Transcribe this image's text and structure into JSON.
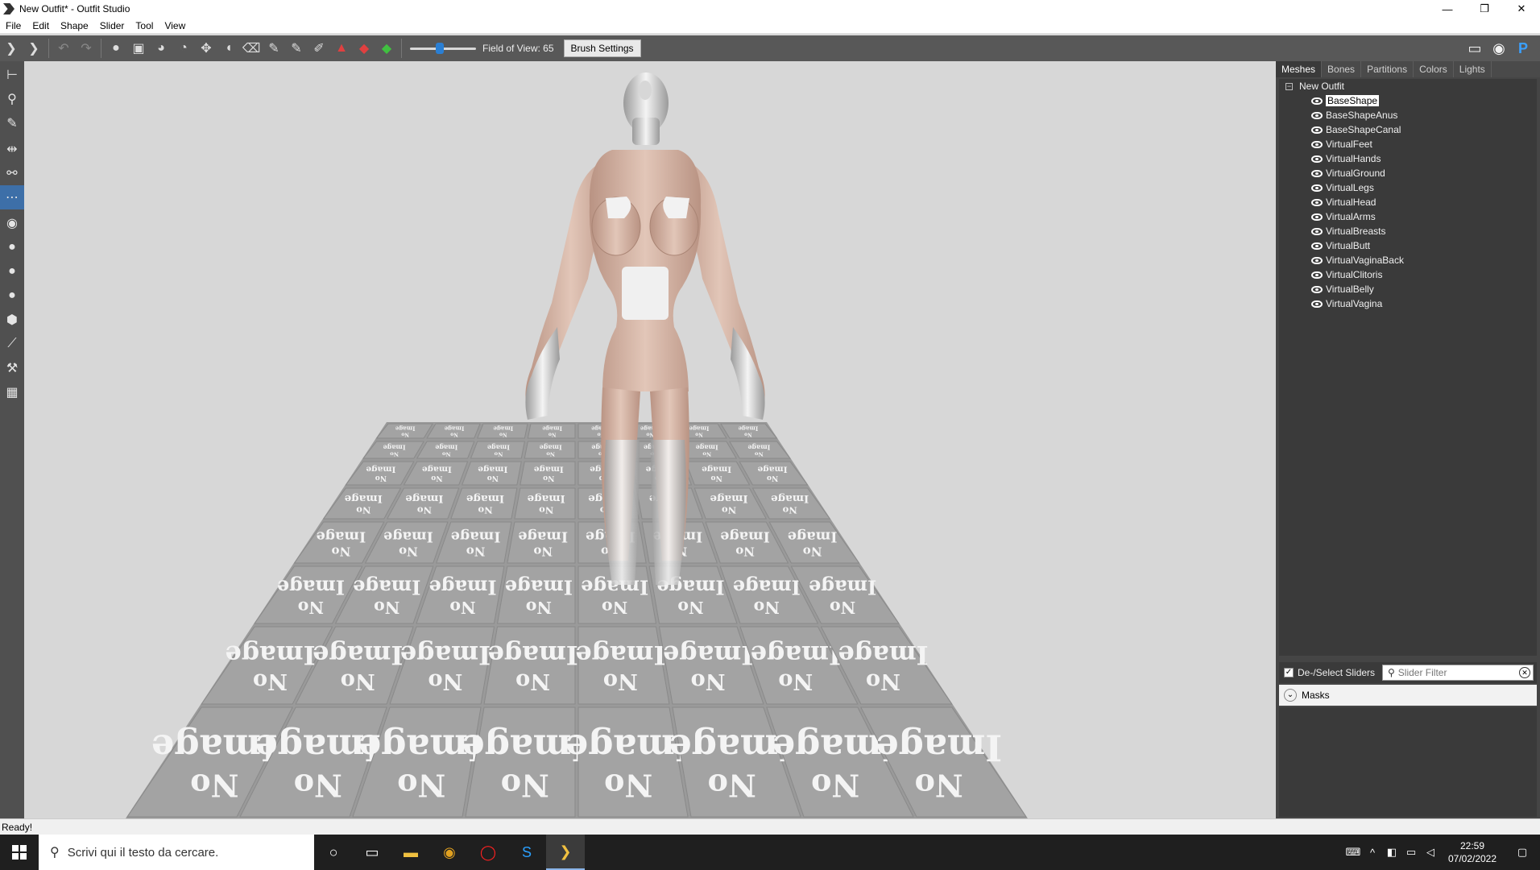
{
  "window": {
    "title": "New Outfit* - Outfit Studio",
    "minimize_glyph": "—",
    "restore_glyph": "❐",
    "close_glyph": "✕"
  },
  "menu": [
    "File",
    "Edit",
    "Shape",
    "Slider",
    "Tool",
    "View"
  ],
  "toolbar": {
    "fov_label": "Field of View: 65",
    "fov_value": 65,
    "fov_fraction": 0.45,
    "brush_settings_label": "Brush Settings"
  },
  "tabs": [
    "Meshes",
    "Bones",
    "Partitions",
    "Colors",
    "Lights"
  ],
  "tree": {
    "root": "New Outfit",
    "items": [
      "BaseShape",
      "BaseShapeAnus",
      "BaseShapeCanal",
      "VirtualFeet",
      "VirtualHands",
      "VirtualGround",
      "VirtualLegs",
      "VirtualHead",
      "VirtualArms",
      "VirtualBreasts",
      "VirtualButt",
      "VirtualVaginaBack",
      "VirtualClitoris",
      "VirtualBelly",
      "VirtualVagina"
    ],
    "selected": "BaseShape"
  },
  "sliders": {
    "deselect_label": "De-/Select Sliders",
    "deselect_checked": true,
    "filter_placeholder": "Slider Filter",
    "masks_label": "Masks"
  },
  "viewport": {
    "floor_tile_text_top": "Image",
    "floor_tile_text_bottom": "No"
  },
  "status": {
    "text": "Ready!"
  },
  "taskbar": {
    "search_placeholder": "Scrivi qui il testo da cercare.",
    "time": "22:59",
    "date": "07/02/2022"
  },
  "colors": {
    "toolbar_bg": "#585858",
    "panel_bg": "#454545",
    "tree_bg": "#3a3a3a",
    "accent": "#2a7fd4",
    "floor": "#9a9a9a",
    "skin": "#d9b8a8",
    "latex": "#e8e8e8"
  }
}
